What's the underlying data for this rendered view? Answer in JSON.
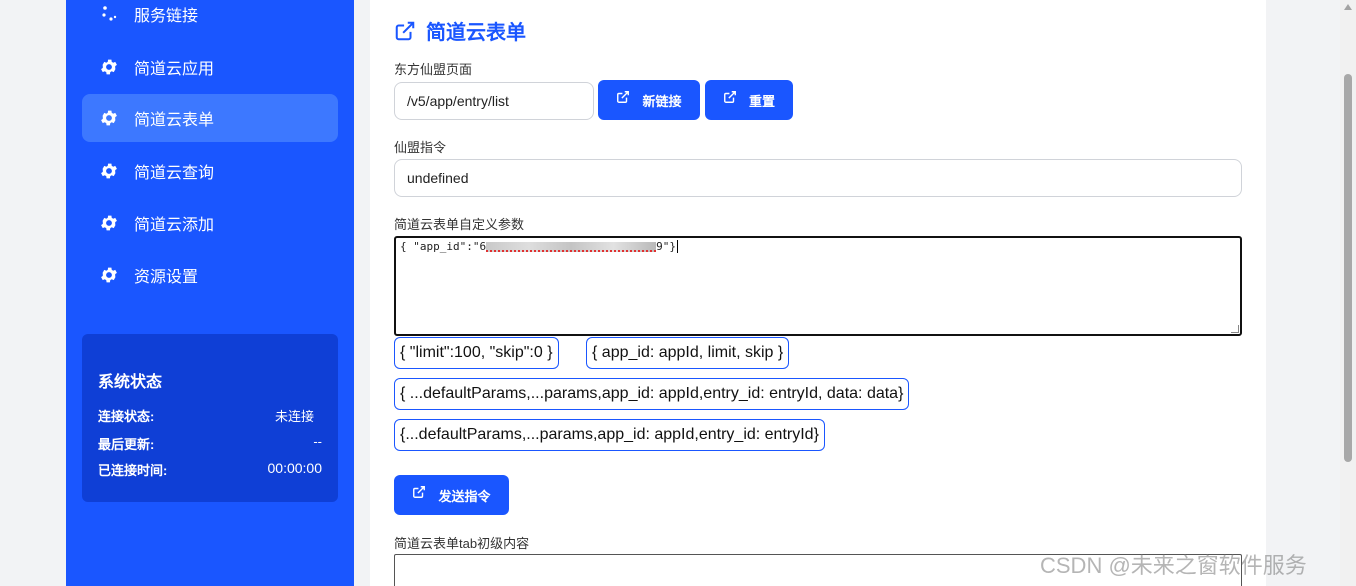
{
  "sidebar": {
    "items": [
      {
        "label": "服务链接",
        "icon": "dots-icon"
      },
      {
        "label": "简道云应用",
        "icon": "gear-icon"
      },
      {
        "label": "简道云表单",
        "icon": "gear-icon",
        "active": true
      },
      {
        "label": "简道云查询",
        "icon": "gear-icon"
      },
      {
        "label": "简道云添加",
        "icon": "gear-icon"
      },
      {
        "label": "资源设置",
        "icon": "gear-icon"
      }
    ],
    "status": {
      "title": "系统状态",
      "rows": [
        {
          "label": "连接状态:",
          "value": "未连接"
        },
        {
          "label": "最后更新:",
          "value": "--"
        },
        {
          "label": "已连接时间:",
          "value": "00:00:00"
        }
      ]
    }
  },
  "main": {
    "title": "简道云表单",
    "page_label": "东方仙盟页面",
    "page_value": "/v5/app/entry/list",
    "new_link_button": "新链接",
    "reset_button": "重置",
    "command_label": "仙盟指令",
    "command_value": "undefined",
    "params_label": "简道云表单自定义参数",
    "params_prefix": "{ \"app_id\":\"6",
    "params_suffix": "9\"}",
    "chips": [
      "{ \"limit\":100, \"skip\":0 }",
      "{ app_id: appId, limit, skip }",
      "{ ...defaultParams,...params,app_id: appId,entry_id: entryId, data: data}",
      "{...defaultParams,...params,app_id: appId,entry_id: entryId}"
    ],
    "send_button": "发送指令",
    "tab_content_label": "简道云表单tab初级内容"
  },
  "watermark": "CSDN @未来之窗软件服务",
  "colors": {
    "accent": "#1a56ff",
    "sidebar_active": "#3d78ff",
    "status_card": "#0f3fd6"
  }
}
